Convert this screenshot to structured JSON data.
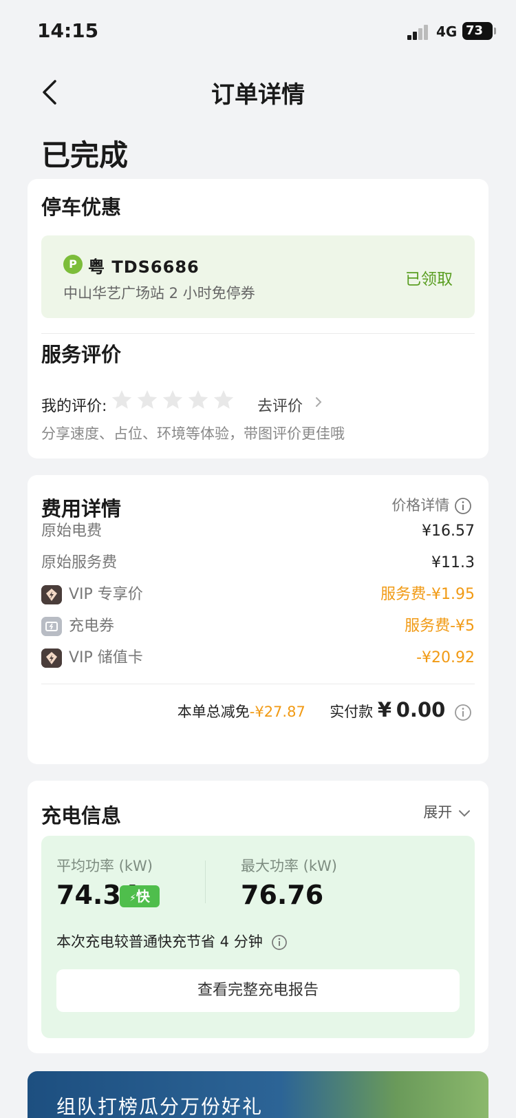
{
  "status_bar": {
    "time": "14:15",
    "network": "4G",
    "battery": "73"
  },
  "nav": {
    "title": "订单详情"
  },
  "order": {
    "status": "已完成"
  },
  "parking": {
    "title": "停车优惠",
    "p_icon": "P",
    "plate": "粤 TDS6686",
    "description": "中山华艺广场站 2 小时免停券",
    "status": "已领取"
  },
  "rating": {
    "title": "服务评价",
    "label": "我的评价:",
    "stars_filled": 0,
    "stars_total": 5,
    "action": "去评价",
    "hint": "分享速度、占位、环境等体验，带图评价更佳哦"
  },
  "fees": {
    "title": "费用详情",
    "price_detail_link": "价格详情",
    "rows": [
      {
        "label": "原始电费",
        "value": "¥16.57",
        "icon": ""
      },
      {
        "label": "原始服务费",
        "value": "¥11.3",
        "icon": ""
      },
      {
        "label": "VIP 专享价",
        "value": "服务费-¥1.95",
        "icon": "vip-diamond-icon"
      },
      {
        "label": "充电券",
        "value": "服务费-¥5",
        "icon": "coupon-ticket-icon"
      },
      {
        "label": "VIP 储值卡",
        "value": "-¥20.92",
        "icon": "vip-diamond-icon"
      }
    ],
    "total_discount_label": "本单总减免",
    "total_discount_value": "-¥27.87",
    "paid_label": "实付款",
    "paid_currency": "¥",
    "paid_amount": "0.00"
  },
  "charging": {
    "title": "充电信息",
    "expand_label": "展开",
    "avg_power_label": "平均功率 (kW)",
    "avg_power_value": "74.34",
    "fast_badge": "快",
    "max_power_label": "最大功率 (kW)",
    "max_power_value": "76.76",
    "saving_text": "本次充电较普通快充节省 4 分钟",
    "report_button": "查看完整充电报告"
  },
  "promo": {
    "text": "组队打榜瓜分万份好礼"
  },
  "colors": {
    "accent_green": "#5a9e22",
    "fast_green": "#4fbe4c",
    "discount_orange": "#f19a14",
    "background": "#f2f3f5"
  }
}
